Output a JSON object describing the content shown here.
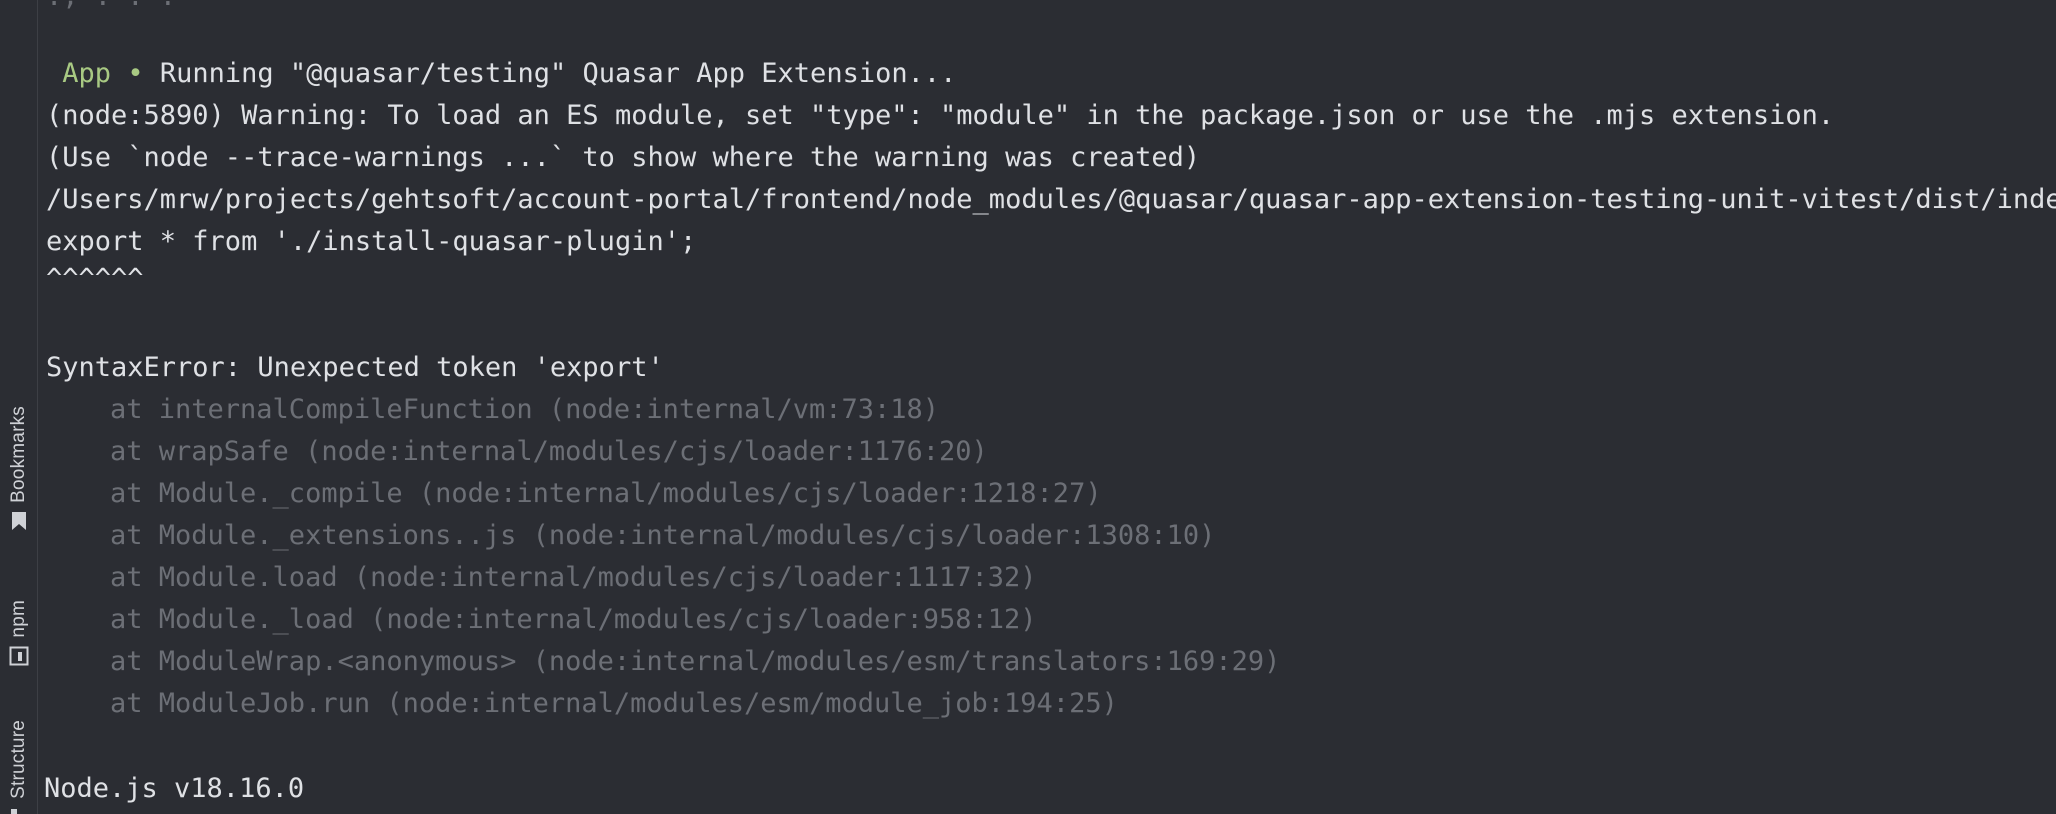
{
  "sidebar": {
    "tabs": [
      {
        "label": "Bookmarks",
        "icon": "bookmark-icon"
      },
      {
        "label": "npm",
        "icon": "npm-icon"
      },
      {
        "label": "Structure",
        "icon": "structure-icon"
      }
    ]
  },
  "terminal": {
    "top_fragment": "., . . .",
    "app_tag": "App",
    "bullet": "•",
    "running": "Running \"@quasar/testing\" Quasar App Extension...",
    "warning": "(node:5890) Warning: To load an ES module, set \"type\": \"module\" in the package.json or use the .mjs extension.",
    "trace_hint": "(Use `node --trace-warnings ...` to show where the warning was created)",
    "path": "/Users/mrw/projects/gehtsoft/account-portal/frontend/node_modules/@quasar/quasar-app-extension-testing-unit-vitest/dist/index.",
    "export_line": "export * from './install-quasar-plugin';",
    "caret": "^^^^^^",
    "error": "SyntaxError: Unexpected token 'export'",
    "stack": [
      "at internalCompileFunction (node:internal/vm:73:18)",
      "at wrapSafe (node:internal/modules/cjs/loader:1176:20)",
      "at Module._compile (node:internal/modules/cjs/loader:1218:27)",
      "at Module._extensions..js (node:internal/modules/cjs/loader:1308:10)",
      "at Module.load (node:internal/modules/cjs/loader:1117:32)",
      "at Module._load (node:internal/modules/cjs/loader:958:12)",
      "at ModuleWrap.<anonymous> (node:internal/modules/esm/translators:169:29)",
      "at ModuleJob.run (node:internal/modules/esm/module_job:194:25)"
    ],
    "node_version": "Node.js v18.16.0"
  }
}
